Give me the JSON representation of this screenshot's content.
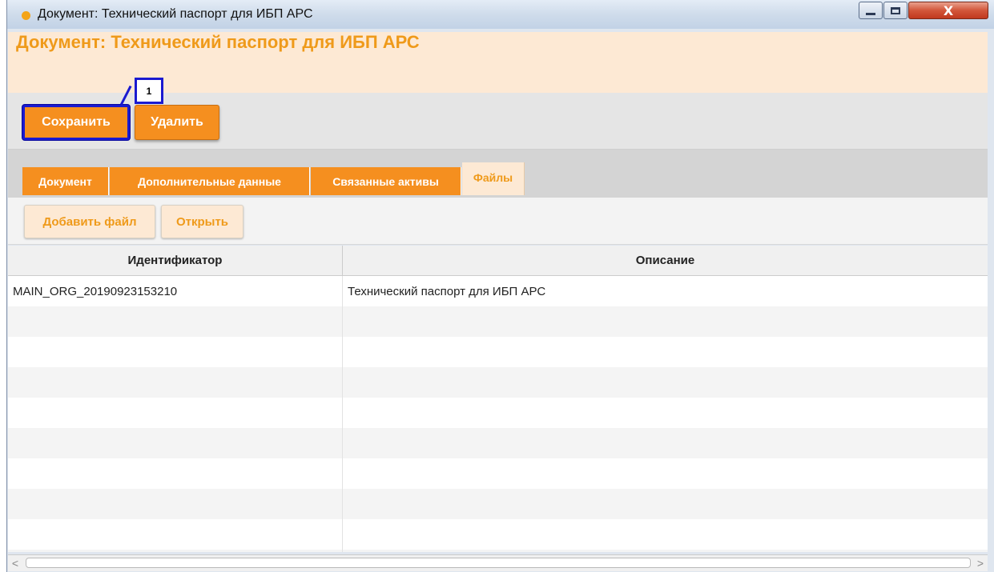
{
  "window": {
    "title": "Документ: Технический паспорт для ИБП АРС",
    "controls": {
      "minimize_icon": "minimize-icon",
      "maximize_icon": "maximize-icon",
      "close_glyph": "X"
    }
  },
  "document": {
    "title": "Документ: Технический паспорт для ИБП АРС"
  },
  "toolbar": {
    "save_label": "Сохранить",
    "delete_label": "Удалить"
  },
  "annotation": {
    "badge_number": "1"
  },
  "tabs": [
    {
      "label": "Документ",
      "active": false
    },
    {
      "label": "Дополнительные данные",
      "active": false
    },
    {
      "label": "Связанные активы",
      "active": false
    },
    {
      "label": "Файлы",
      "active": true
    }
  ],
  "files_toolbar": {
    "add_file_label": "Добавить файл",
    "open_label": "Открыть"
  },
  "table": {
    "columns": [
      "Идентификатор",
      "Описание"
    ],
    "rows": [
      [
        "MAIN_ORG_20190923153210",
        "Технический паспорт для ИБП АРС"
      ],
      [
        "",
        ""
      ],
      [
        "",
        ""
      ],
      [
        "",
        ""
      ],
      [
        "",
        ""
      ],
      [
        "",
        ""
      ],
      [
        "",
        ""
      ],
      [
        "",
        ""
      ],
      [
        "",
        ""
      ],
      [
        "",
        ""
      ]
    ]
  },
  "scrollbar": {
    "left_arrow": "<",
    "right_arrow": ">"
  },
  "colors": {
    "accent": "#f58f1f",
    "accent_light": "#fde9d4",
    "title_text": "#ef9a1a",
    "annotation": "#1a1ad0"
  }
}
